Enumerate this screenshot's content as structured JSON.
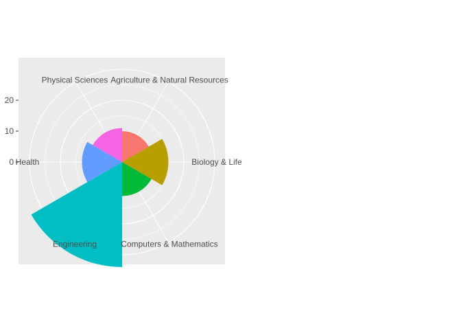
{
  "chart_data": {
    "type": "bar",
    "coord": "polar",
    "categories": [
      "Agriculture & Natural Resources",
      "Biology & Life",
      "Computers & Mathematics",
      "Engineering",
      "Health",
      "Physical Sciences"
    ],
    "values": [
      10,
      15,
      11,
      34,
      13,
      11
    ],
    "colors": [
      "#F8766D",
      "#B79F00",
      "#00BA38",
      "#00BFC4",
      "#619CFF",
      "#F564E3"
    ],
    "y_ticks": [
      "0",
      "10",
      "20"
    ],
    "y_tick_values": [
      0,
      10,
      20
    ],
    "ylim": [
      0,
      30
    ],
    "grid": true,
    "legend": "none",
    "panel_color": "#EBEBEB",
    "grid_color": "#FFFFFF"
  }
}
